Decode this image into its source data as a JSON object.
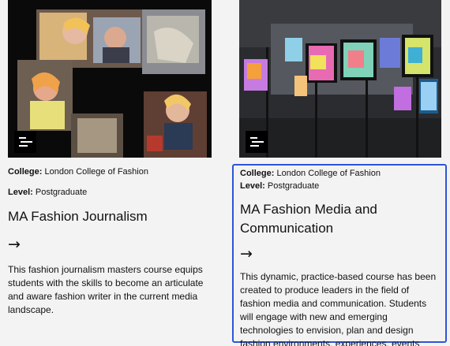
{
  "cards": [
    {
      "college_label": "College:",
      "college_value": "London College of Fashion",
      "level_label": "Level:",
      "level_value": "Postgraduate",
      "title": "MA Fashion Journalism",
      "arrow": "→",
      "description": "This fashion journalism masters course equips students with the skills to become an articulate and aware fashion writer in the current media landscape."
    },
    {
      "college_label": "College:",
      "college_value": "London College of Fashion",
      "level_label": "Level:",
      "level_value": "Postgraduate",
      "title": "MA Fashion Media and Communication",
      "arrow": "→",
      "description": "This dynamic, practice-based course has been created to produce leaders in the field of fashion media and communication. Students will engage with new and emerging technologies to envision, plan and design fashion environments, experiences, events"
    }
  ],
  "colors": {
    "focus_outline": "#2d55d8",
    "background": "#f3f3f3",
    "badge": "#000000"
  },
  "icons": {
    "thumbnail_badge": "menu-lines-icon"
  }
}
